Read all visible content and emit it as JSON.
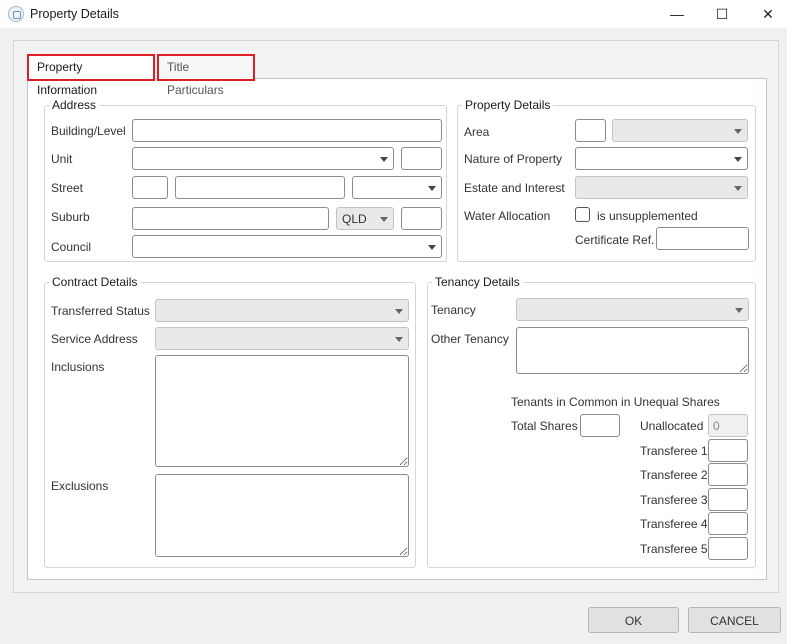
{
  "window": {
    "title": "Property Details",
    "controls": {
      "minimize": "—",
      "maximize": "☐",
      "close": "✕"
    }
  },
  "tabs": [
    {
      "label": "Property Information",
      "active": true
    },
    {
      "label": "Title Particulars",
      "active": false
    }
  ],
  "address": {
    "title": "Address",
    "building_label": "Building/Level",
    "unit_label": "Unit",
    "street_label": "Street",
    "suburb_label": "Suburb",
    "state_value": "QLD",
    "council_label": "Council"
  },
  "property_details": {
    "title": "Property Details",
    "area_label": "Area",
    "nature_label": "Nature of Property",
    "estate_label": "Estate and Interest",
    "water_label": "Water Allocation",
    "unsupplemented_label": "is unsupplemented",
    "certificate_label": "Certificate Ref."
  },
  "contract_details": {
    "title": "Contract Details",
    "transferred_label": "Transferred Status",
    "service_label": "Service Address",
    "inclusions_label": "Inclusions",
    "exclusions_label": "Exclusions"
  },
  "tenancy_details": {
    "title": "Tenancy Details",
    "tenancy_label": "Tenancy",
    "other_label": "Other Tenancy",
    "tic_heading": "Tenants in Common in Unequal Shares",
    "total_shares_label": "Total Shares",
    "unallocated_label": "Unallocated",
    "unallocated_value": "0",
    "transferees": [
      "Transferee 1",
      "Transferee 2",
      "Transferee 3",
      "Transferee 4",
      "Transferee 5"
    ]
  },
  "buttons": {
    "ok": "OK",
    "cancel": "CANCEL"
  }
}
